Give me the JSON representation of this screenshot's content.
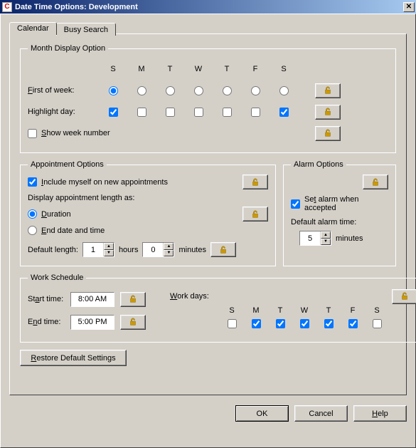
{
  "title": "Date Time Options:  Development",
  "tabs": {
    "calendar": "Calendar",
    "busy": "Busy Search"
  },
  "month": {
    "legend": "Month Display Option",
    "days": [
      "S",
      "M",
      "T",
      "W",
      "T",
      "F",
      "S"
    ],
    "first_label": "First of week:",
    "first_selected_index": 0,
    "highlight_label": "Highlight day:",
    "highlight": [
      true,
      false,
      false,
      false,
      false,
      false,
      true
    ],
    "show_week_label": "Show week number",
    "show_week": false
  },
  "appt": {
    "legend": "Appointment Options",
    "include_label": "Include myself on new appointments",
    "include": true,
    "display_as_label": "Display appointment length as:",
    "duration_label": "Duration",
    "enddate_label": "End date and time",
    "display_as": "duration",
    "default_len_label": "Default length:",
    "hours": "1",
    "hours_label": "hours",
    "minutes": "0",
    "minutes_label": "minutes"
  },
  "alarm": {
    "legend": "Alarm Options",
    "set_label": "Set alarm when accepted",
    "set": true,
    "default_time_label": "Default alarm time:",
    "value": "5",
    "unit": "minutes"
  },
  "work": {
    "legend": "Work Schedule",
    "start_label": "Start time:",
    "start": "8:00 AM",
    "end_label": "End time:",
    "end": "5:00 PM",
    "workdays_label": "Work days:",
    "days": [
      "S",
      "M",
      "T",
      "W",
      "T",
      "F",
      "S"
    ],
    "checked": [
      false,
      true,
      true,
      true,
      true,
      true,
      false
    ]
  },
  "buttons": {
    "restore": "Restore Default Settings",
    "ok": "OK",
    "cancel": "Cancel",
    "help": "Help"
  }
}
